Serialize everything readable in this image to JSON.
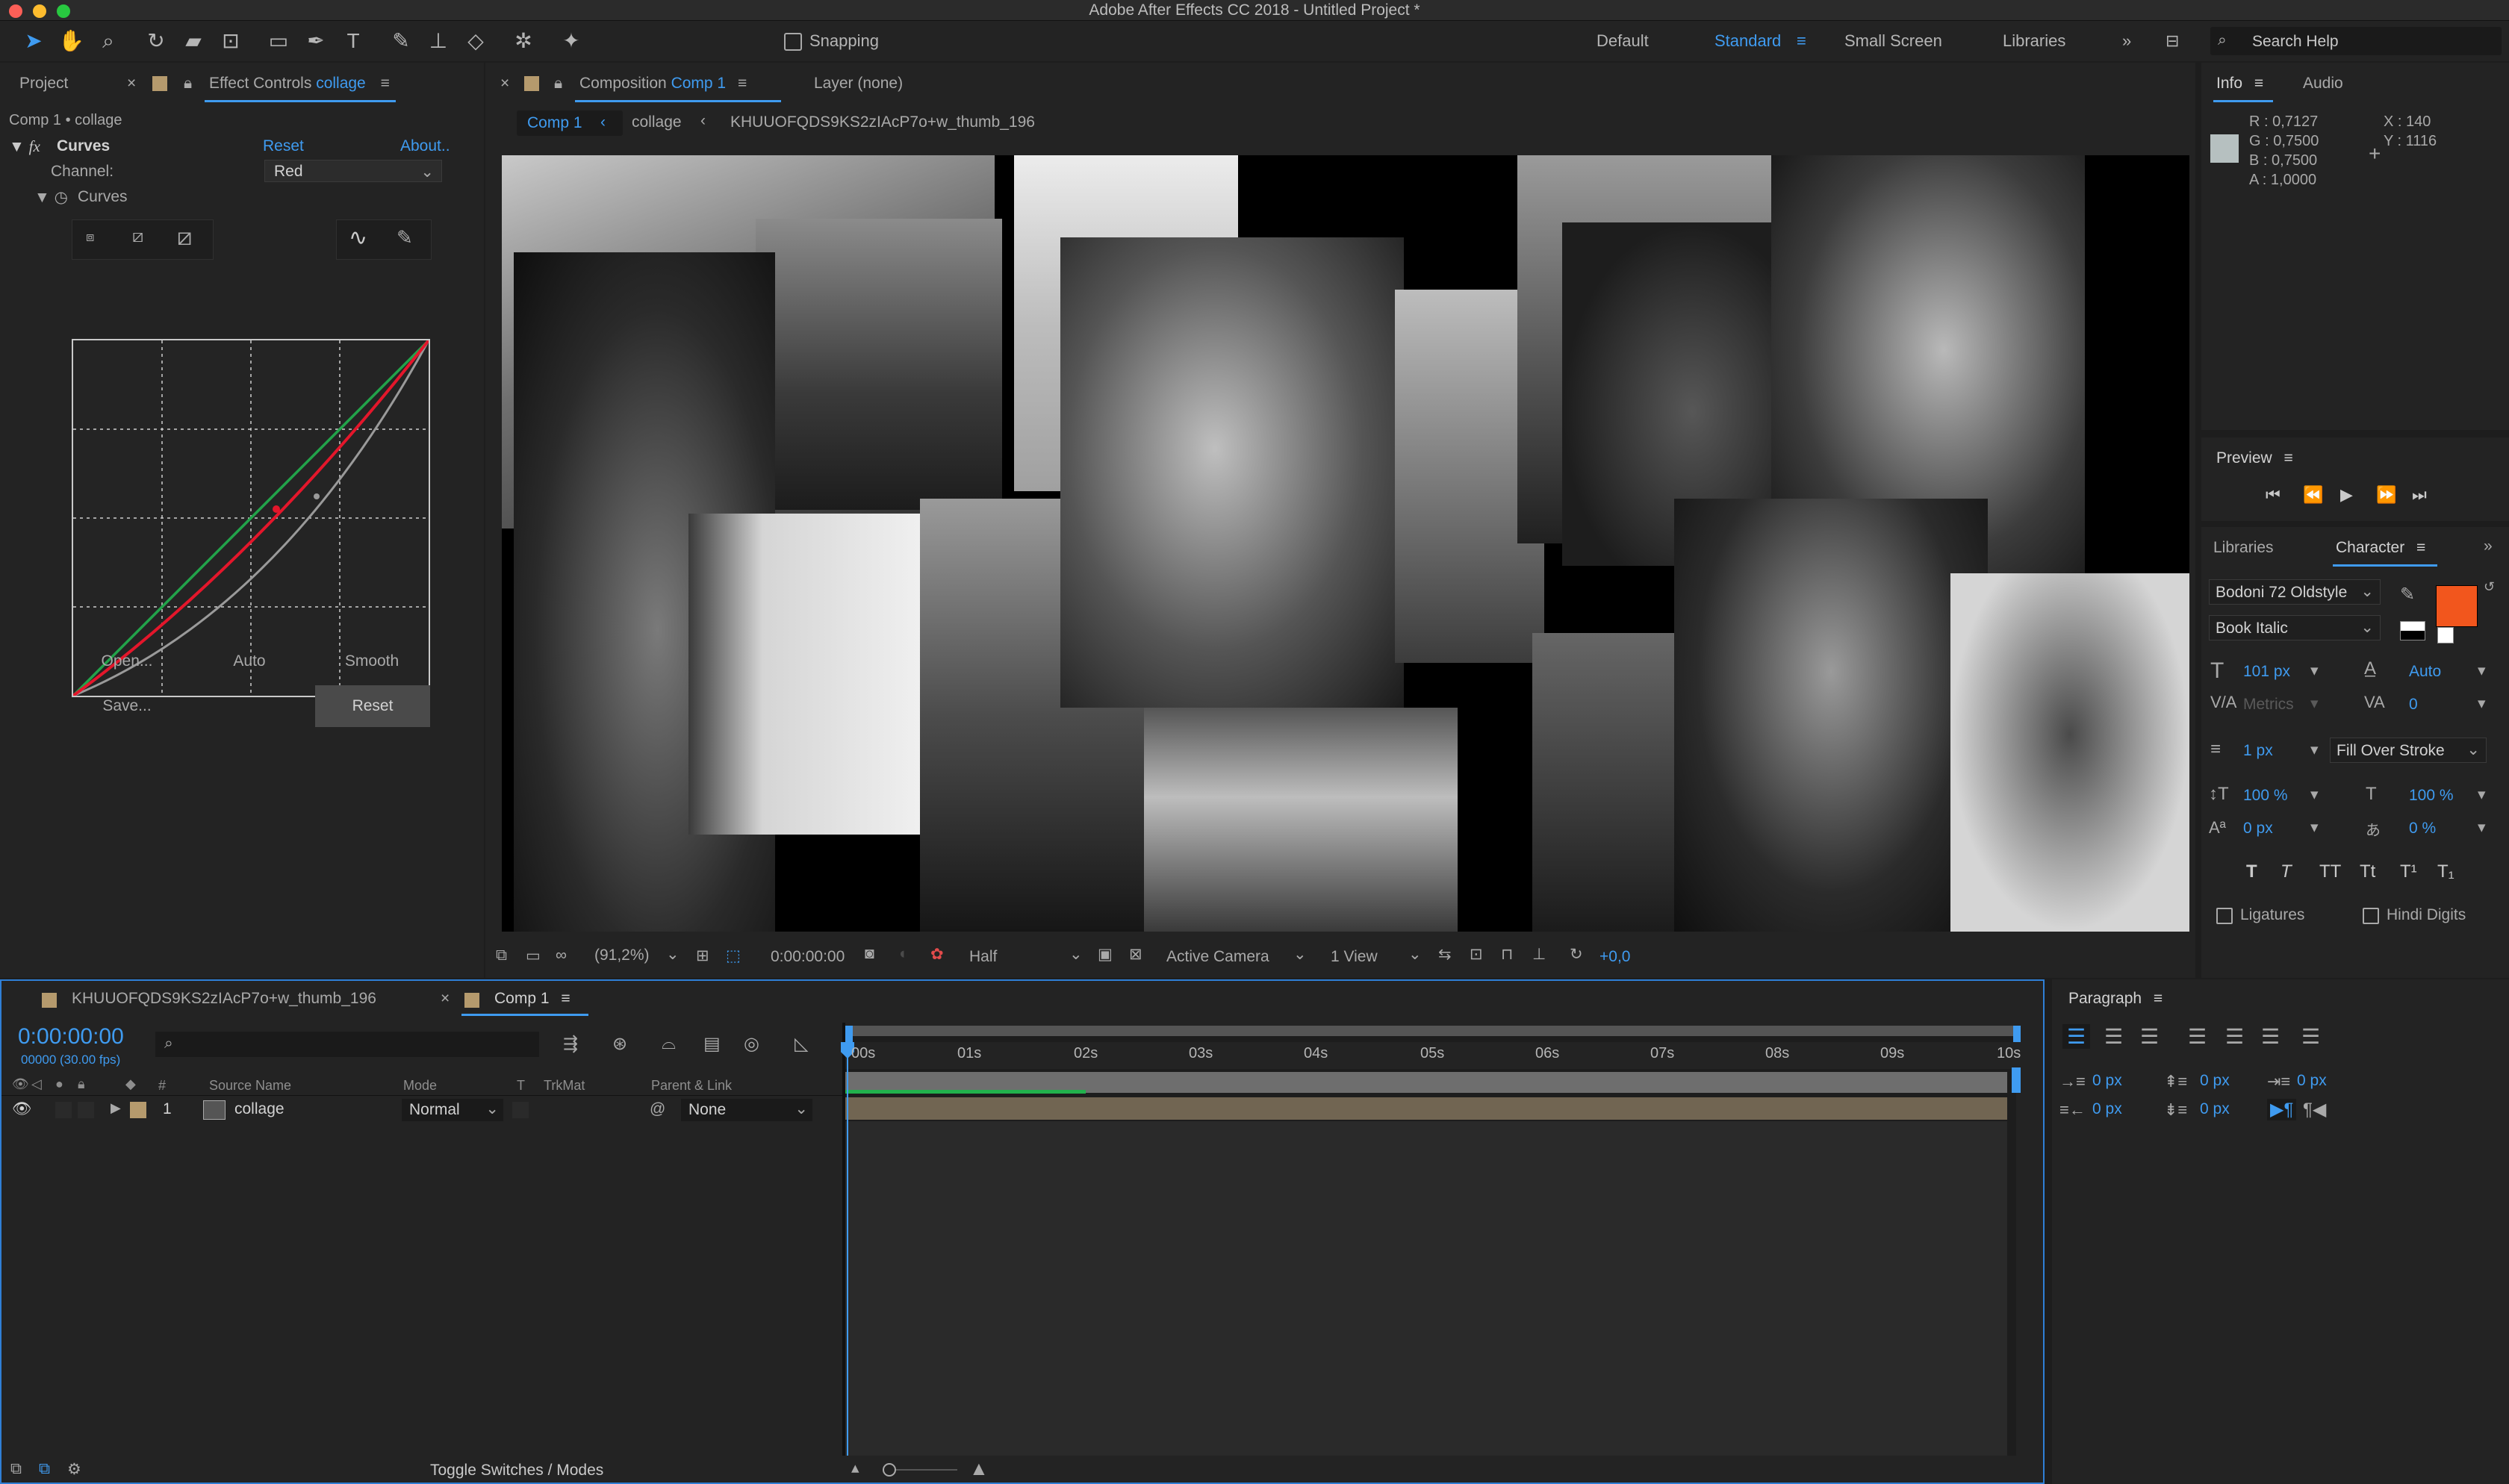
{
  "app": {
    "title": "Adobe After Effects CC 2018 - Untitled Project *"
  },
  "toolbar": {
    "snapping": "Snapping",
    "workspaces": [
      "Default",
      "Standard",
      "Small Screen",
      "Libraries"
    ],
    "search_placeholder": "Search Help"
  },
  "left_panel": {
    "tabs": [
      "Project",
      "Effect Controls"
    ],
    "effect_target": "collage",
    "breadcrumb": "Comp 1 • collage",
    "effect_name": "Curves",
    "reset": "Reset",
    "about": "About..",
    "channel_label": "Channel:",
    "channel_value": "Red",
    "curves_label": "Curves",
    "open": "Open...",
    "auto": "Auto",
    "smooth": "Smooth",
    "save": "Save...",
    "reset_btn": "Reset"
  },
  "composition": {
    "tab_label": "Composition",
    "comp_name": "Comp 1",
    "layer_tab": "Layer (none)",
    "nav": [
      "Comp 1",
      "collage",
      "KHUUOFQDS9KS2zIAcP7o+w_thumb_196"
    ],
    "zoom": "(91,2%)",
    "time": "0:00:00:00",
    "resolution": "Half",
    "camera": "Active Camera",
    "views": "1 View",
    "exposure": "+0,0"
  },
  "info": {
    "tabs": [
      "Info",
      "Audio"
    ],
    "r": "R : 0,7127",
    "g": "G : 0,7500",
    "b": "B : 0,7500",
    "a": "A : 1,0000",
    "x": "X : 140",
    "y": "Y : 1116"
  },
  "preview": {
    "title": "Preview"
  },
  "character": {
    "tabs": [
      "Libraries",
      "Character"
    ],
    "font": "Bodoni 72 Oldstyle",
    "style": "Book Italic",
    "size": "101 px",
    "leading": "Auto",
    "kerning": "Metrics",
    "tracking": "0",
    "stroke_width": "1 px",
    "stroke_type": "Fill Over Stroke",
    "vscale": "100 %",
    "hscale": "100 %",
    "baseline": "0 px",
    "tsume": "0 %",
    "ligatures": "Ligatures",
    "hindi": "Hindi Digits",
    "fill_color": "#f2561d",
    "glyphs": [
      "T",
      "T",
      "TT",
      "Tt",
      "T¹",
      "T₁"
    ]
  },
  "timeline": {
    "tabs": [
      "KHUUOFQDS9KS2zIAcP7o+w_thumb_196",
      "Comp 1"
    ],
    "timecode": "0:00:00:00",
    "fps": "00000 (30.00 fps)",
    "columns": [
      "#",
      "Source Name",
      "Mode",
      "T",
      "TrkMat",
      "Parent & Link"
    ],
    "layer": {
      "num": "1",
      "name": "collage",
      "mode": "Normal",
      "parent": "None"
    },
    "ruler": [
      "00s",
      "01s",
      "02s",
      "03s",
      "04s",
      "05s",
      "06s",
      "07s",
      "08s",
      "09s",
      "10s"
    ],
    "toggle": "Toggle Switches / Modes"
  },
  "paragraph": {
    "title": "Paragraph",
    "indent_vals": [
      "0 px",
      "0 px",
      "0 px",
      "0 px",
      "0 px"
    ]
  }
}
